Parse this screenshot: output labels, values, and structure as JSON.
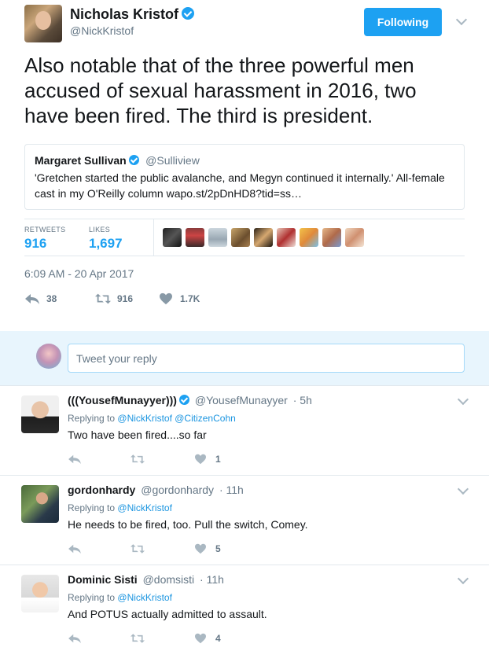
{
  "tweet": {
    "author_name": "Nicholas Kristof",
    "author_handle": "@NickKristof",
    "follow_label": "Following",
    "text": "Also notable that of the three powerful men accused of sexual harassment in 2016, two have been fired. The third is president.",
    "timestamp": "6:09 AM - 20 Apr 2017",
    "quote": {
      "name": "Margaret Sullivan",
      "handle": "@Sulliview",
      "text": "'Gretchen started the public avalanche, and Megyn continued it internally.' All-female cast in my O'Reilly column wapo.st/2pDnHD8?tid=ss…"
    },
    "stats": {
      "retweets_label": "RETWEETS",
      "retweets": "916",
      "likes_label": "LIKES",
      "likes": "1,697"
    },
    "actions": {
      "replies": "38",
      "retweets": "916",
      "likes": "1.7K"
    }
  },
  "reply_box": {
    "placeholder": "Tweet your reply"
  },
  "replies": [
    {
      "name": "(((YousefMunayyer)))",
      "verified": true,
      "handle": "@YousefMunayyer",
      "time": "· 5h",
      "replying_label": "Replying to",
      "mentions": "@NickKristof @CitizenCohn",
      "text": "Two have been fired....so far",
      "likes": "1"
    },
    {
      "name": "gordonhardy",
      "verified": false,
      "handle": "@gordonhardy",
      "time": "· 11h",
      "replying_label": "Replying to",
      "mentions": "@NickKristof",
      "text": "He needs to be fired, too. Pull the switch, Comey.",
      "likes": "5"
    },
    {
      "name": "Dominic Sisti",
      "verified": false,
      "handle": "@domsisti",
      "time": "· 11h",
      "replying_label": "Replying to",
      "mentions": "@NickKristof",
      "text": "And POTUS actually admitted to assault.",
      "likes": "4"
    }
  ],
  "colors": {
    "accent": "#1da1f2",
    "muted": "#657786",
    "reply_bar_bg": "#e8f5fd"
  }
}
